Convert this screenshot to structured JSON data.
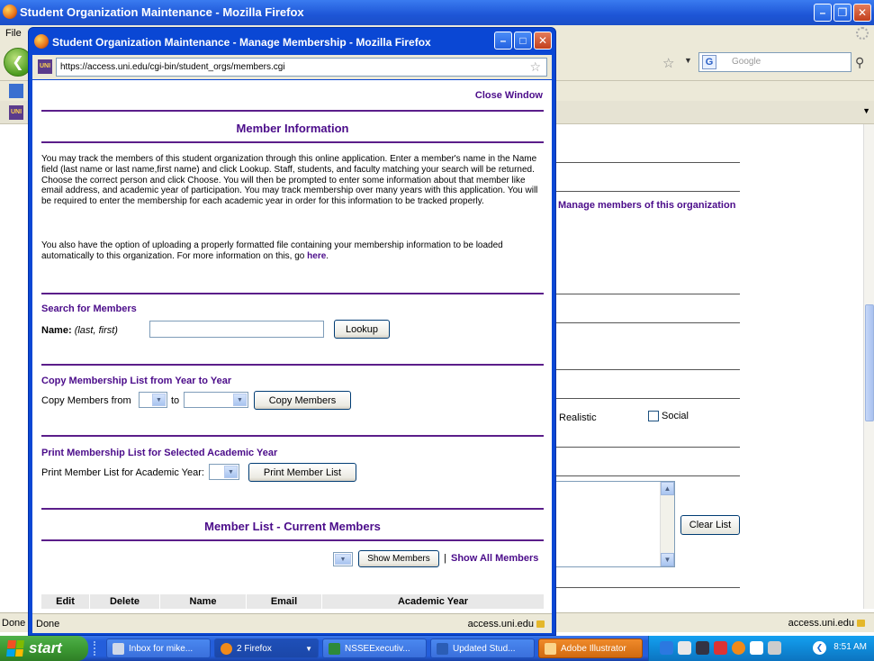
{
  "bg_window": {
    "title": "Student Organization Maintenance - Mozilla Firefox",
    "menu_file": "File",
    "search_placeholder": "Google",
    "manage_link": "Manage members of this organization",
    "interest_realistic": "Realistic",
    "interest_social": "Social",
    "clear_list_label": "Clear List",
    "status_left": "Done",
    "status_right": "access.uni.edu"
  },
  "popup": {
    "title": "Student Organization Maintenance - Manage Membership - Mozilla Firefox",
    "url": "https://access.uni.edu/cgi-bin/student_orgs/members.cgi",
    "close_window": "Close Window",
    "member_info_title": "Member Information",
    "intro_para": "You may track the members of this student organization through this online application. Enter a member's name in the Name field (last name or last name,first name) and click Lookup. Staff, students, and faculty matching your search will be returned. Choose the correct person and click Choose. You will then be prompted to enter some information about that member like email address, and academic year of participation. You may track membership over many years with this application. You will be required to enter the membership for each academic year in order for this information to be tracked properly.",
    "upload_para": "You also have the option of uploading a properly formatted file containing your membership information to be loaded automatically to this organization. For more information on this, go",
    "here_link": "here",
    "search_heading": "Search for Members",
    "name_label": "Name:",
    "name_hint": "(last, first)",
    "name_value": "",
    "lookup_label": "Lookup",
    "copy_heading": "Copy Membership List from Year to Year",
    "copy_from_label": "Copy Members from",
    "copy_to_label": "to",
    "copy_button": "Copy Members",
    "print_heading": "Print Membership List for Selected Academic Year",
    "print_label": "Print Member List for Academic Year:",
    "print_button": "Print Member List",
    "member_list_title": "Member List - Current Members",
    "show_members_button": "Show Members",
    "separator": "|",
    "show_all_link": "Show All Members",
    "columns": [
      "Edit",
      "Delete",
      "Name",
      "Email",
      "Academic Year"
    ],
    "status_left": "Done",
    "status_right": "access.uni.edu"
  },
  "taskbar": {
    "start_label": "start",
    "tasks": [
      "Inbox for mike...",
      "2 Firefox",
      "NSSEExecutiv...",
      "Updated Stud...",
      "Adobe Illustrator"
    ],
    "clock": "8:51 AM"
  },
  "colors": {
    "accent_purple": "#4b0c8a",
    "xp_blue": "#0a47d4",
    "start_green": "#3c9a33"
  }
}
